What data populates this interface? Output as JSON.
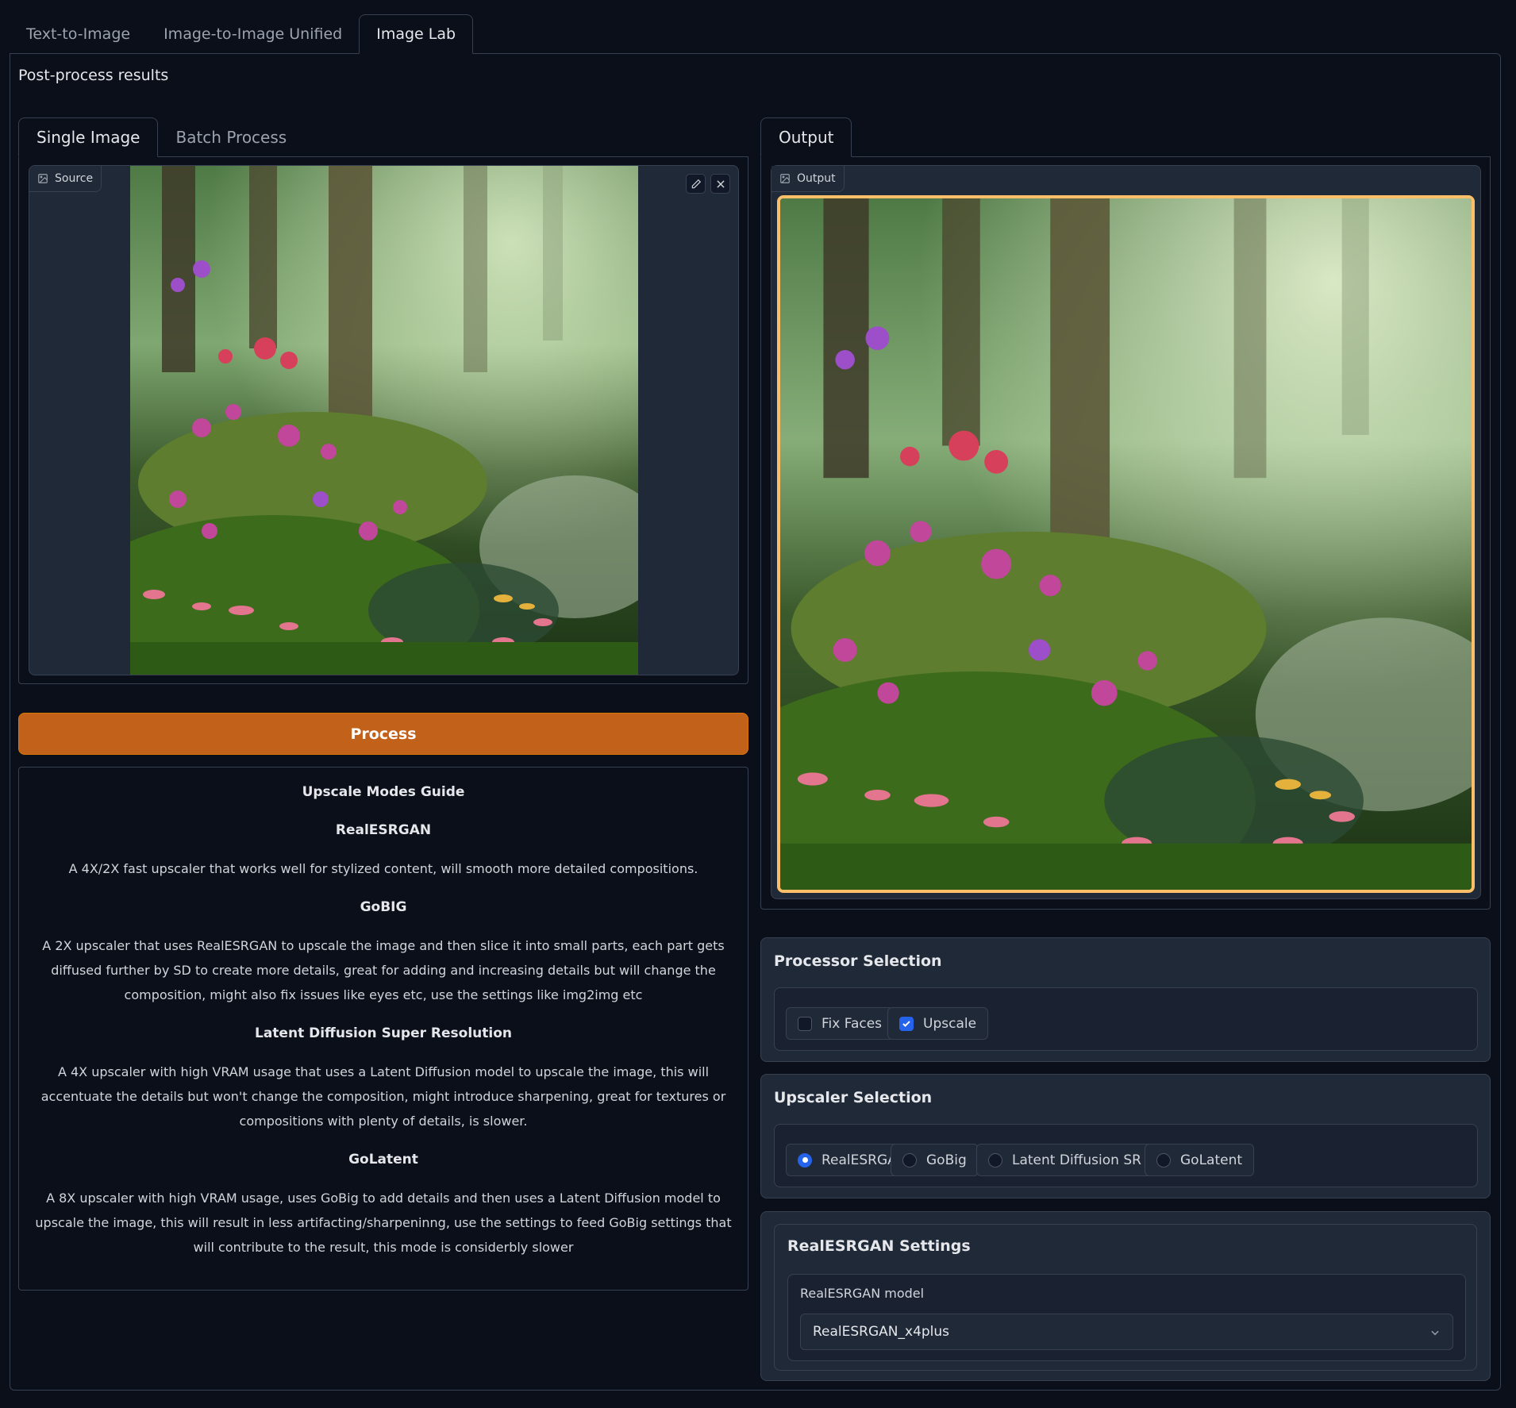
{
  "top_tabs": [
    "Text-to-Image",
    "Image-to-Image Unified",
    "Image Lab"
  ],
  "post_process_title": "Post-process results",
  "left_tabs": [
    "Single Image",
    "Batch Process"
  ],
  "source_label": "Source",
  "process_label": "Process",
  "guide": {
    "title": "Upscale Modes Guide",
    "realesrgan_title": "RealESRGAN",
    "realesrgan_text": "A 4X/2X fast upscaler that works well for stylized content, will smooth more detailed compositions.",
    "gobig_title": "GoBIG",
    "gobig_text": "A 2X upscaler that uses RealESRGAN to upscale the image and then slice it into small parts, each part gets diffused further by SD to create more details, great for adding and increasing details but will change the composition, might also fix issues like eyes etc, use the settings like img2img etc",
    "ldsr_title": "Latent Diffusion Super Resolution",
    "ldsr_text": "A 4X upscaler with high VRAM usage that uses a Latent Diffusion model to upscale the image, this will accentuate the details but won't change the composition, might introduce sharpening, great for textures or compositions with plenty of details, is slower.",
    "golatent_title": "GoLatent",
    "golatent_text": "A 8X upscaler with high VRAM usage, uses GoBig to add details and then uses a Latent Diffusion model to upscale the image, this will result in less artifacting/sharpeninng, use the settings to feed GoBig settings that will contribute to the result, this mode is considerbly slower"
  },
  "output_tab": "Output",
  "output_label": "Output",
  "processor_selection": {
    "title": "Processor Selection",
    "options": [
      {
        "label": "Fix Faces",
        "checked": false
      },
      {
        "label": "Upscale",
        "checked": true
      }
    ]
  },
  "upscaler_selection": {
    "title": "Upscaler Selection",
    "options": [
      {
        "label": "RealESRGAN",
        "selected": true
      },
      {
        "label": "GoBig",
        "selected": false
      },
      {
        "label": "Latent Diffusion SR",
        "selected": false
      },
      {
        "label": "GoLatent",
        "selected": false
      }
    ]
  },
  "realesrgan_settings": {
    "title": "RealESRGAN Settings",
    "model_label": "RealESRGAN model",
    "model_value": "RealESRGAN_x4plus"
  },
  "colors": {
    "accent": "#c2611a",
    "selected": "#2563eb",
    "output_border": "#fbbf6a"
  }
}
